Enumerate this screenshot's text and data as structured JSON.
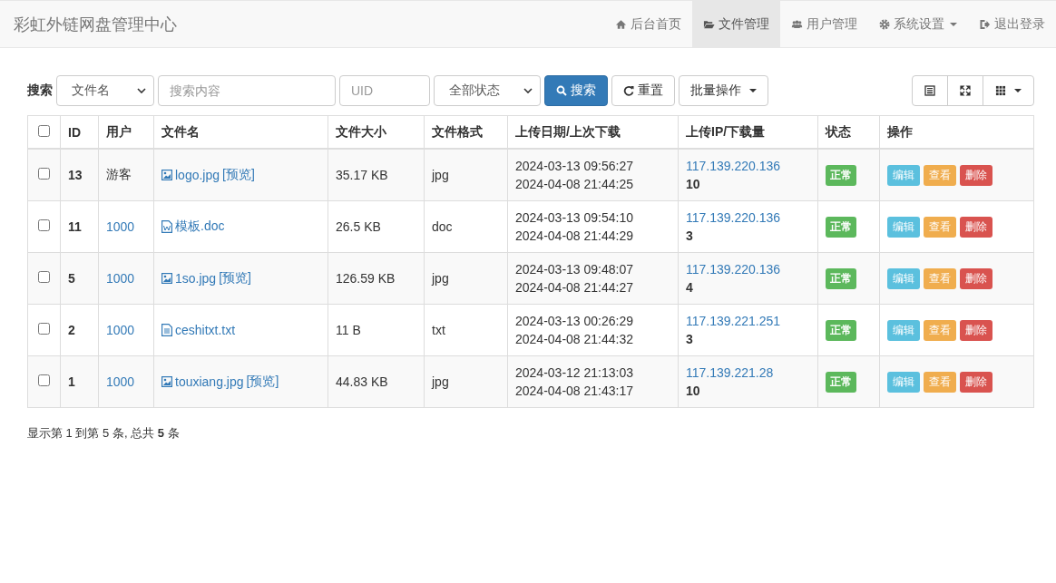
{
  "navbar": {
    "brand": "彩虹外链网盘管理中心",
    "items": [
      {
        "label": "后台首页",
        "kind": "home",
        "selected": false,
        "dropdown": false
      },
      {
        "label": "文件管理",
        "kind": "folder",
        "selected": true,
        "dropdown": false
      },
      {
        "label": "用户管理",
        "kind": "users",
        "selected": false,
        "dropdown": false
      },
      {
        "label": "系统设置",
        "kind": "settings",
        "selected": false,
        "dropdown": true
      },
      {
        "label": "退出登录",
        "kind": "logout",
        "selected": false,
        "dropdown": false
      }
    ]
  },
  "toolbar": {
    "label": "搜索",
    "field_select": "文件名",
    "search_placeholder": "搜索内容",
    "uid_placeholder": "UID",
    "status_select": "全部状态",
    "search_button": "搜索",
    "reset_button": "重置",
    "batch_button": "批量操作"
  },
  "table": {
    "columns": [
      "ID",
      "用户",
      "文件名",
      "文件大小",
      "文件格式",
      "上传日期/上次下载",
      "上传IP/下载量",
      "状态",
      "操作"
    ],
    "header_checked": false,
    "rows": [
      {
        "checked": false,
        "id": "13",
        "user": "游客",
        "user_link": false,
        "file": {
          "kind": "image",
          "name": "logo.jpg",
          "preview": "[预览]"
        },
        "size": "35.17 KB",
        "format": "jpg",
        "uploaded": "2024-03-13 09:56:27",
        "last_download": "2024-04-08 21:44:25",
        "ip": "117.139.220.136",
        "downloads": "10",
        "status": {
          "label": "正常",
          "kind": "normal"
        },
        "actions": [
          "编辑",
          "查看",
          "删除"
        ]
      },
      {
        "checked": false,
        "id": "11",
        "user": "1000",
        "user_link": true,
        "file": {
          "kind": "word",
          "name": "模板.doc"
        },
        "size": "26.5 KB",
        "format": "doc",
        "uploaded": "2024-03-13 09:54:10",
        "last_download": "2024-04-08 21:44:29",
        "ip": "117.139.220.136",
        "downloads": "3",
        "status": {
          "label": "正常",
          "kind": "normal"
        },
        "actions": [
          "编辑",
          "查看",
          "删除"
        ]
      },
      {
        "checked": false,
        "id": "5",
        "user": "1000",
        "user_link": true,
        "file": {
          "kind": "image",
          "name": "1so.jpg",
          "preview": "[预览]"
        },
        "size": "126.59 KB",
        "format": "jpg",
        "uploaded": "2024-03-13 09:48:07",
        "last_download": "2024-04-08 21:44:27",
        "ip": "117.139.220.136",
        "downloads": "4",
        "status": {
          "label": "正常",
          "kind": "normal"
        },
        "actions": [
          "编辑",
          "查看",
          "删除"
        ]
      },
      {
        "checked": false,
        "id": "2",
        "user": "1000",
        "user_link": true,
        "file": {
          "kind": "text",
          "name": "ceshitxt.txt"
        },
        "size": "11 B",
        "format": "txt",
        "uploaded": "2024-03-13 00:26:29",
        "last_download": "2024-04-08 21:44:32",
        "ip": "117.139.221.251",
        "downloads": "3",
        "status": {
          "label": "正常",
          "kind": "normal"
        },
        "actions": [
          "编辑",
          "查看",
          "删除"
        ]
      },
      {
        "checked": false,
        "id": "1",
        "user": "1000",
        "user_link": true,
        "file": {
          "kind": "image",
          "name": "touxiang.jpg",
          "preview": "[预览]"
        },
        "size": "44.83 KB",
        "format": "jpg",
        "uploaded": "2024-03-12 21:13:03",
        "last_download": "2024-04-08 21:43:17",
        "ip": "117.139.221.28",
        "downloads": "10",
        "status": {
          "label": "正常",
          "kind": "normal"
        },
        "actions": [
          "编辑",
          "查看",
          "删除"
        ]
      }
    ]
  },
  "pagination_info": "显示第 1 到第 5 条, 总共 **5** 条"
}
